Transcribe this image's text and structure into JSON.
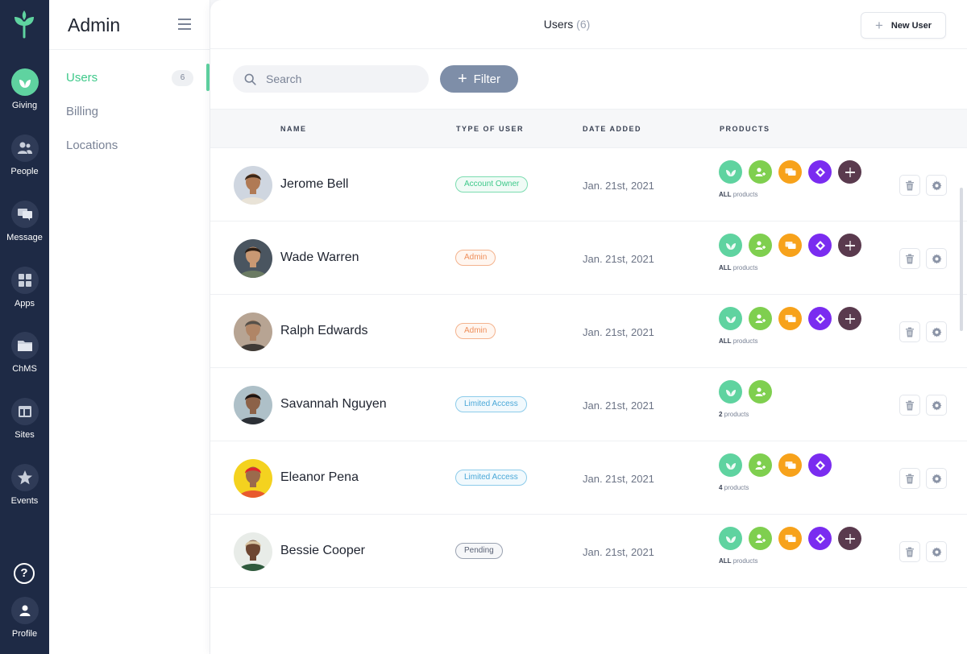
{
  "rail": {
    "items": [
      {
        "label": "Giving",
        "icon": "leaf-icon"
      },
      {
        "label": "People",
        "icon": "people-icon"
      },
      {
        "label": "Message",
        "icon": "message-icon"
      },
      {
        "label": "Apps",
        "icon": "apps-grid-icon"
      },
      {
        "label": "ChMS",
        "icon": "folder-icon"
      },
      {
        "label": "Sites",
        "icon": "layout-icon"
      },
      {
        "label": "Events",
        "icon": "star-icon"
      }
    ],
    "help": "?",
    "profile": "Profile"
  },
  "sidebar": {
    "title": "Admin",
    "items": [
      {
        "label": "Users",
        "badge": "6"
      },
      {
        "label": "Billing"
      },
      {
        "label": "Locations"
      }
    ]
  },
  "header": {
    "title": "Users",
    "count": "(6)",
    "new_user_label": "New User"
  },
  "toolbar": {
    "search_placeholder": "Search",
    "filter_label": "Filter"
  },
  "table": {
    "columns": [
      "NAME",
      "TYPE OF USER",
      "DATE ADDED",
      "PRODUCTS"
    ],
    "rows": [
      {
        "name": "Jerome Bell",
        "type": "Account Owner",
        "date": "Jan. 21st, 2021",
        "count": "ALL",
        "suffix": " products"
      },
      {
        "name": "Wade Warren",
        "type": "Admin",
        "date": "Jan. 21st, 2021",
        "count": "ALL",
        "suffix": " products"
      },
      {
        "name": "Ralph Edwards",
        "type": "Admin",
        "date": "Jan. 21st, 2021",
        "count": "ALL",
        "suffix": " products"
      },
      {
        "name": "Savannah Nguyen",
        "type": "Limited Access",
        "date": "Jan. 21st, 2021",
        "count": "2",
        "suffix": " products"
      },
      {
        "name": "Eleanor Pena",
        "type": "Limited Access",
        "date": "Jan. 21st, 2021",
        "count": "4",
        "suffix": " products"
      },
      {
        "name": "Bessie Cooper",
        "type": "Pending",
        "date": "Jan. 21st, 2021",
        "count": "ALL",
        "suffix": " products"
      }
    ]
  },
  "colors": {
    "rail_bg": "#1e2a45",
    "accent_green": "#5fd3a0",
    "product_giving": "#5fd3a0",
    "product_people": "#7fcf4f",
    "product_message": "#f7a21b",
    "product_apps": "#7a2cf0",
    "product_chms": "#5a3a4e"
  }
}
